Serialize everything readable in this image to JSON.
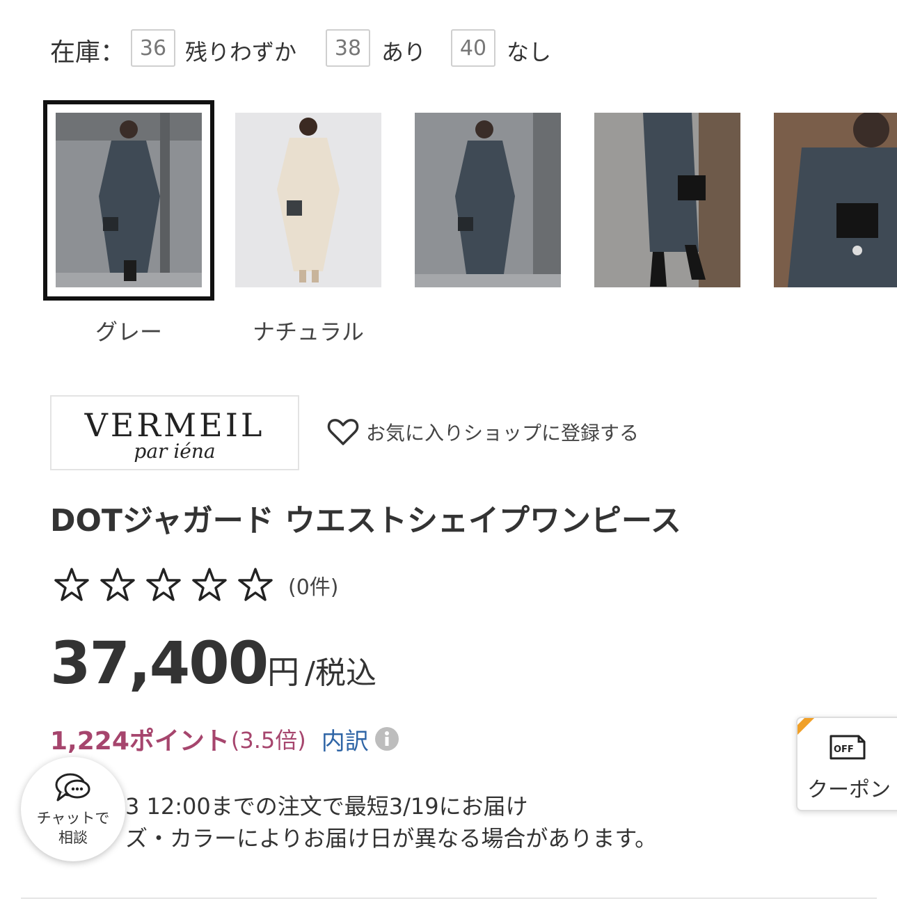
{
  "stock": {
    "label": "在庫：",
    "items": [
      {
        "size": "36",
        "status": "残りわずか"
      },
      {
        "size": "38",
        "status": "あり"
      },
      {
        "size": "40",
        "status": "なし"
      }
    ]
  },
  "colors": [
    {
      "label": "グレー",
      "selected": true
    },
    {
      "label": "ナチュラル",
      "selected": false
    }
  ],
  "shop": {
    "logo_main": "VERMEIL",
    "logo_sub": "par iéna",
    "favorite_label": "お気に入りショップに登録する"
  },
  "product": {
    "title": "DOTジャガード ウエストシェイプワンピース",
    "rating_count": "(0件)",
    "price": "37,400",
    "price_unit": "円",
    "price_tax": "/税込",
    "points": "1,224ポイント",
    "points_multiplier": "(3.5倍)",
    "points_breakdown": "内訳",
    "delivery_line1": "3 12:00までの注文で最短3/19にお届け",
    "delivery_line2": "ズ・カラーによりお届け日が異なる場合があります。"
  },
  "chat": {
    "line1": "チャットで",
    "line2": "相談"
  },
  "coupon": {
    "label": "クーポン",
    "icon_text": "OFF"
  },
  "theme": {
    "points_color": "#a6456d",
    "link_color": "#2f65a6",
    "ribbon_color": "#f0a028"
  }
}
